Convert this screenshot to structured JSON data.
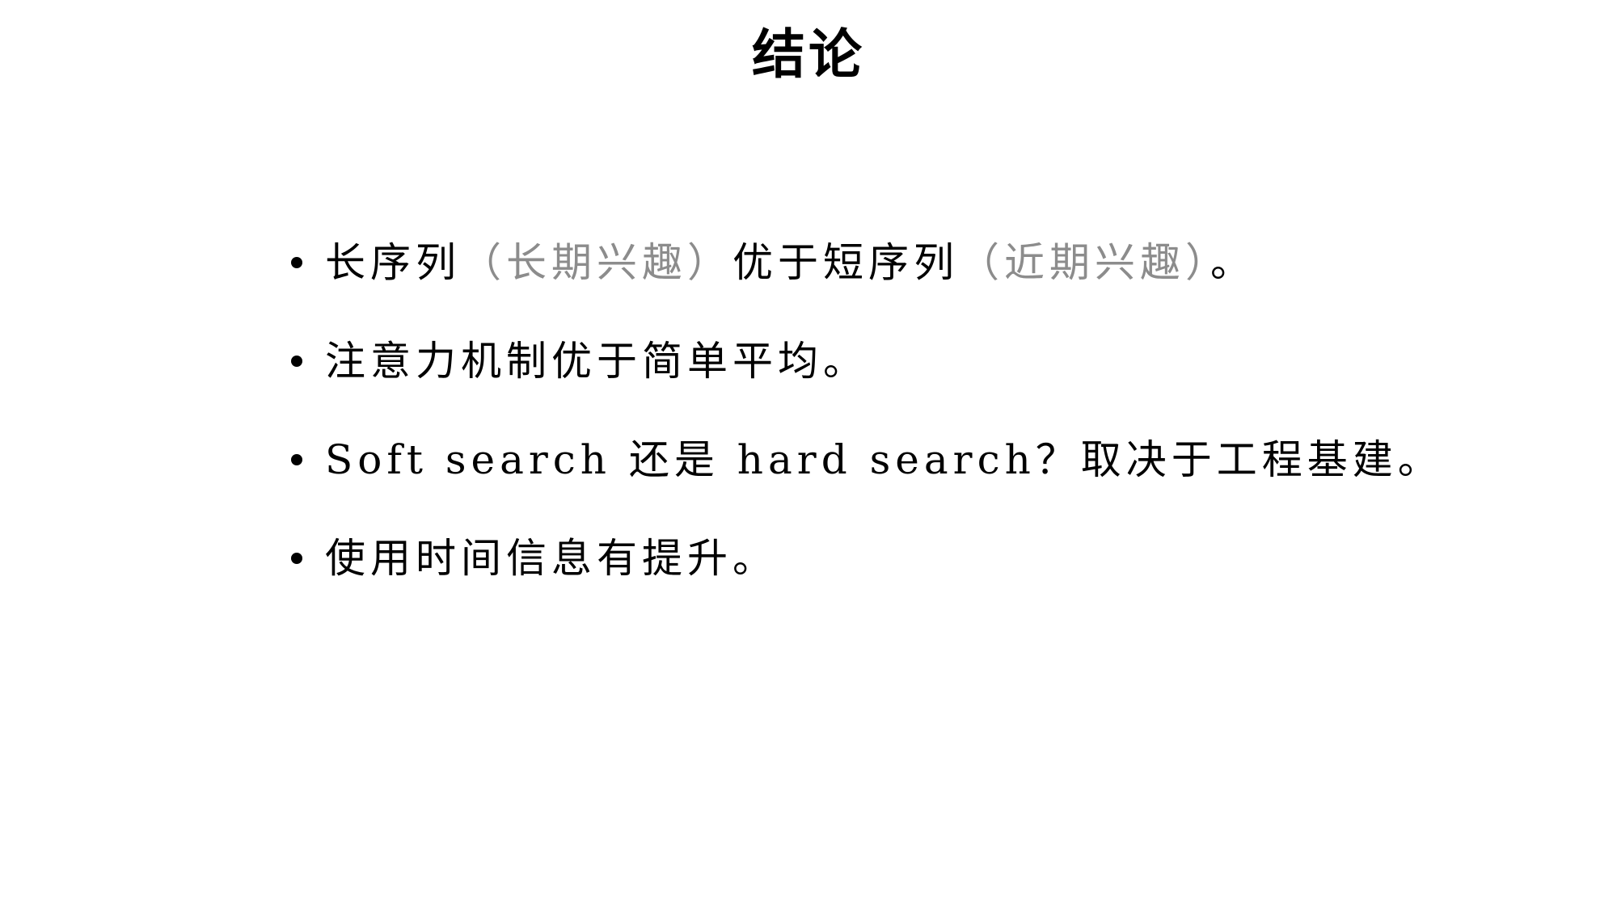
{
  "slide": {
    "title": "结论",
    "bullets": [
      {
        "parts": [
          {
            "text": "长序列",
            "style": "normal"
          },
          {
            "text": "（长期兴趣）",
            "style": "muted"
          },
          {
            "text": "优于短序列",
            "style": "normal"
          },
          {
            "text": "（近期兴趣）",
            "style": "muted"
          },
          {
            "text": "。",
            "style": "normal"
          }
        ]
      },
      {
        "parts": [
          {
            "text": "注意力机制优于简单平均。",
            "style": "normal"
          }
        ]
      },
      {
        "parts": [
          {
            "text": "Soft search 还是 hard search？取决于工程基建。",
            "style": "normal"
          }
        ]
      },
      {
        "parts": [
          {
            "text": "使用时间信息有提升。",
            "style": "normal"
          }
        ]
      }
    ]
  },
  "colors": {
    "text": "#000000",
    "muted": "#8c8c8c",
    "background": "#ffffff"
  }
}
